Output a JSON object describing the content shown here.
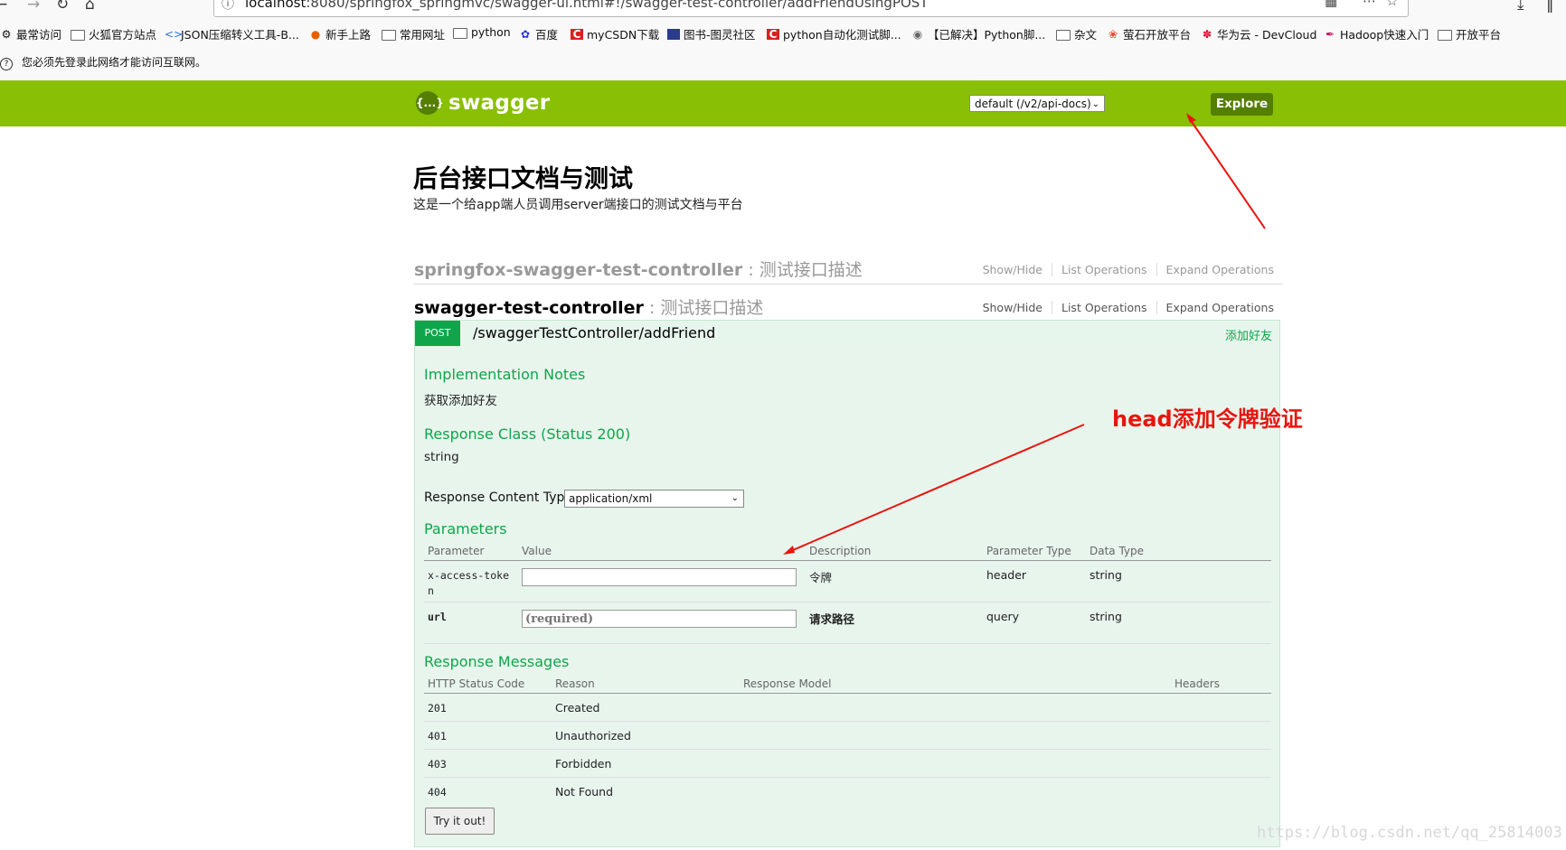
{
  "browser": {
    "url_prefix": "localhost",
    "url_rest": ":8080/springfox_springmvc/swagger-ui.html#!/swagger-test-controller/addFriendUsingPOST",
    "notice": "您必须先登录此网络才能访问互联网。",
    "bookmarks": [
      "最常访问",
      "火狐官方站点",
      "JSON压缩转义工具-B...",
      "新手上路",
      "常用网址",
      "python",
      "百度",
      "myCSDN下载",
      "图书-图灵社区",
      "python自动化测试脚...",
      "【已解决】Python脚...",
      "杂文",
      "萤石开放平台",
      "华为云 - DevCloud",
      "Hadoop快速入门",
      "开放平台"
    ]
  },
  "header": {
    "logo_text": "swagger",
    "api_select": "default (/v2/api-docs)",
    "explore_label": "Explore"
  },
  "info": {
    "title": "后台接口文档与测试",
    "description": "这是一个给app端人员调用server端接口的测试文档与平台"
  },
  "resources": [
    {
      "name": "springfox-swagger-test-controller",
      "desc": " : 测试接口描述",
      "ops": [
        "Show/Hide",
        "List Operations",
        "Expand Operations"
      ]
    },
    {
      "name": "swagger-test-controller",
      "desc": " : 测试接口描述",
      "ops": [
        "Show/Hide",
        "List Operations",
        "Expand Operations"
      ]
    }
  ],
  "operation": {
    "method": "POST",
    "path": "/swaggerTestController/addFriend",
    "summary": "添加好友",
    "impl_title": "Implementation Notes",
    "impl_text": "获取添加好友",
    "response_class_title": "Response Class (Status 200)",
    "response_class": "string",
    "rct_label": "Response Content Type",
    "rct_value": "application/xml",
    "params_title": "Parameters",
    "param_headers": [
      "Parameter",
      "Value",
      "Description",
      "Parameter Type",
      "Data Type"
    ],
    "params": [
      {
        "name": "x-access-token",
        "value": "",
        "placeholder": "",
        "description": "令牌",
        "type": "header",
        "data_type": "string"
      },
      {
        "name": "url",
        "value": "",
        "placeholder": "(required)",
        "description": "请求路径",
        "type": "query",
        "data_type": "string"
      }
    ],
    "resp_title": "Response Messages",
    "resp_headers": [
      "HTTP Status Code",
      "Reason",
      "Response Model",
      "Headers"
    ],
    "responses": [
      {
        "code": "201",
        "reason": "Created"
      },
      {
        "code": "401",
        "reason": "Unauthorized"
      },
      {
        "code": "403",
        "reason": "Forbidden"
      },
      {
        "code": "404",
        "reason": "Not Found"
      }
    ],
    "try_label": "Try it out!"
  },
  "annotation": {
    "text": "head添加令牌验证",
    "color": "#e8150f"
  },
  "watermark": "https://blog.csdn.net/qq_25814003",
  "colors": {
    "swagger_green": "#89bf04",
    "dark_green": "#547f00",
    "post_green": "#10a54a",
    "post_bg": "#e8f5ed"
  }
}
